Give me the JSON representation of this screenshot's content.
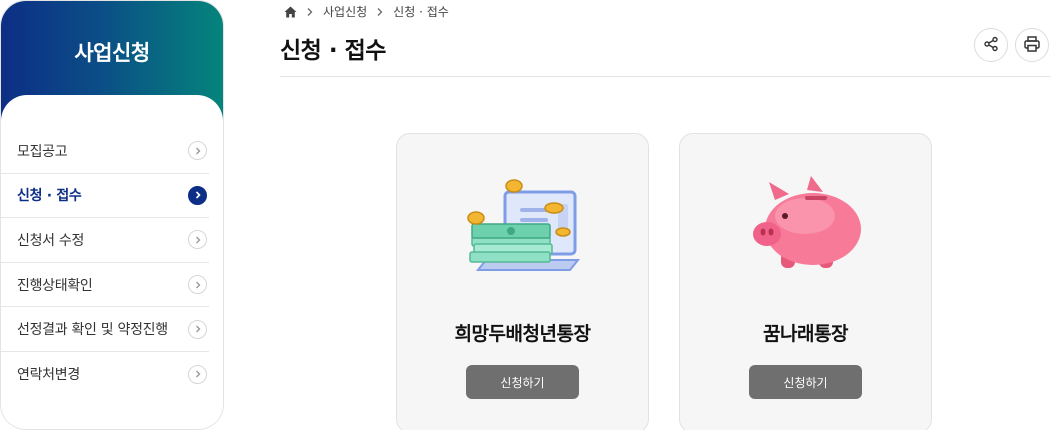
{
  "sidebar": {
    "title": "사업신청",
    "items": [
      {
        "label": "모집공고",
        "active": false
      },
      {
        "label": "신청 · 접수",
        "active": true
      },
      {
        "label": "신청서 수정",
        "active": false
      },
      {
        "label": "진행상태확인",
        "active": false
      },
      {
        "label": "선정결과 확인 및 약정진행",
        "active": false
      },
      {
        "label": "연락처변경",
        "active": false
      }
    ]
  },
  "breadcrumb": {
    "home_icon": "home-icon",
    "items": [
      "사업신청",
      "신청 · 접수"
    ]
  },
  "header": {
    "title": "신청 · 접수",
    "share_icon": "share-icon",
    "print_icon": "print-icon"
  },
  "cards": [
    {
      "title": "희망두배청년통장",
      "button_label": "신청하기",
      "illustration": "money-laptop-icon"
    },
    {
      "title": "꿈나래통장",
      "button_label": "신청하기",
      "illustration": "piggy-bank-icon"
    }
  ],
  "colors": {
    "brand_navy": "#0d2e86",
    "brand_teal": "#05847c",
    "button_gray": "#6f6f6f"
  }
}
